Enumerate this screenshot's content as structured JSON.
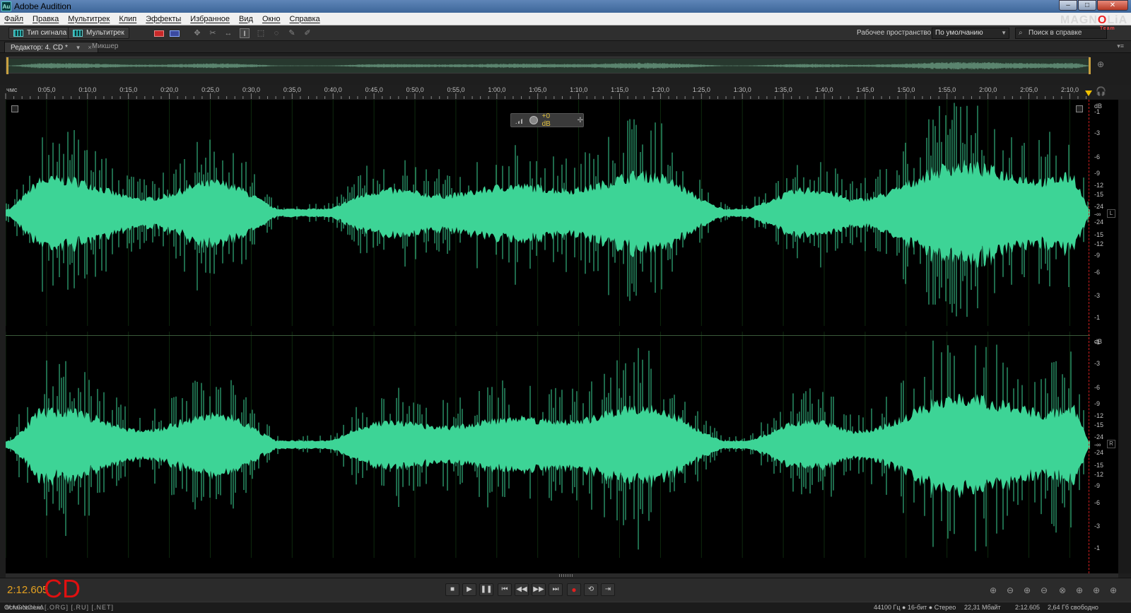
{
  "window": {
    "app_icon": "Au",
    "title": "Adobe Audition",
    "controls": {
      "minimize": "–",
      "maximize": "□",
      "close": "✕"
    }
  },
  "menu": [
    "Файл",
    "Правка",
    "Мультитрек",
    "Клип",
    "Эффекты",
    "Избранное",
    "Вид",
    "Окно",
    "Справка"
  ],
  "toolbar": {
    "waveform_button": "Тип сигнала",
    "multitrack_button": "Мультитрек",
    "workspace_label": "Рабочее пространство:",
    "workspace_value": "По умолчанию",
    "search_placeholder": "Поиск в справке"
  },
  "watermark_logo": {
    "text_a": "MAGN",
    "text_o": "O",
    "text_b": "LiA",
    "sub": "Team"
  },
  "tabs": {
    "editor": "Редактор: 4. CD *",
    "mixer": "Микшер"
  },
  "ruler": {
    "unit": "чмс",
    "labels": [
      "0:05,0",
      "0:10,0",
      "0:15,0",
      "0:20,0",
      "0:25,0",
      "0:30,0",
      "0:35,0",
      "0:40,0",
      "0:45,0",
      "0:50,0",
      "0:55,0",
      "1:00,0",
      "1:05,0",
      "1:10,0",
      "1:15,0",
      "1:20,0",
      "1:25,0",
      "1:30,0",
      "1:35,0",
      "1:40,0",
      "1:45,0",
      "1:50,0",
      "1:55,0",
      "2:00,0",
      "2:05,0",
      "2:10,0"
    ]
  },
  "hud": {
    "value": "+0 dB"
  },
  "scale": {
    "unit": "dB",
    "labels": [
      "-1",
      "-3",
      "-6",
      "-9",
      "-12",
      "-15",
      "-24",
      "-∞",
      "-24",
      "-15",
      "-12",
      "-9",
      "-6",
      "-3",
      "-1"
    ],
    "left_channel": "L",
    "right_channel": "R"
  },
  "colors": {
    "waveform": "#3dd496",
    "time": "#e4a020",
    "playhead": "#d02020"
  },
  "transport": {
    "time": "2:12.605",
    "cd_label": "CD",
    "buttons": [
      "■",
      "▶",
      "❚❚",
      "⏮",
      "◀◀",
      "▶▶",
      "⏭",
      "●",
      "⟲",
      "⇥"
    ]
  },
  "status": {
    "left": "Остановлено",
    "watermark": "MAGNOLiA[.ORG] [.RU] [.NET]",
    "format": "44100 Гц ● 16-бит ● Стерео",
    "size": "22,31 Мбайт",
    "duration": "2:12.605",
    "free": "2,64 Гб свободно"
  }
}
